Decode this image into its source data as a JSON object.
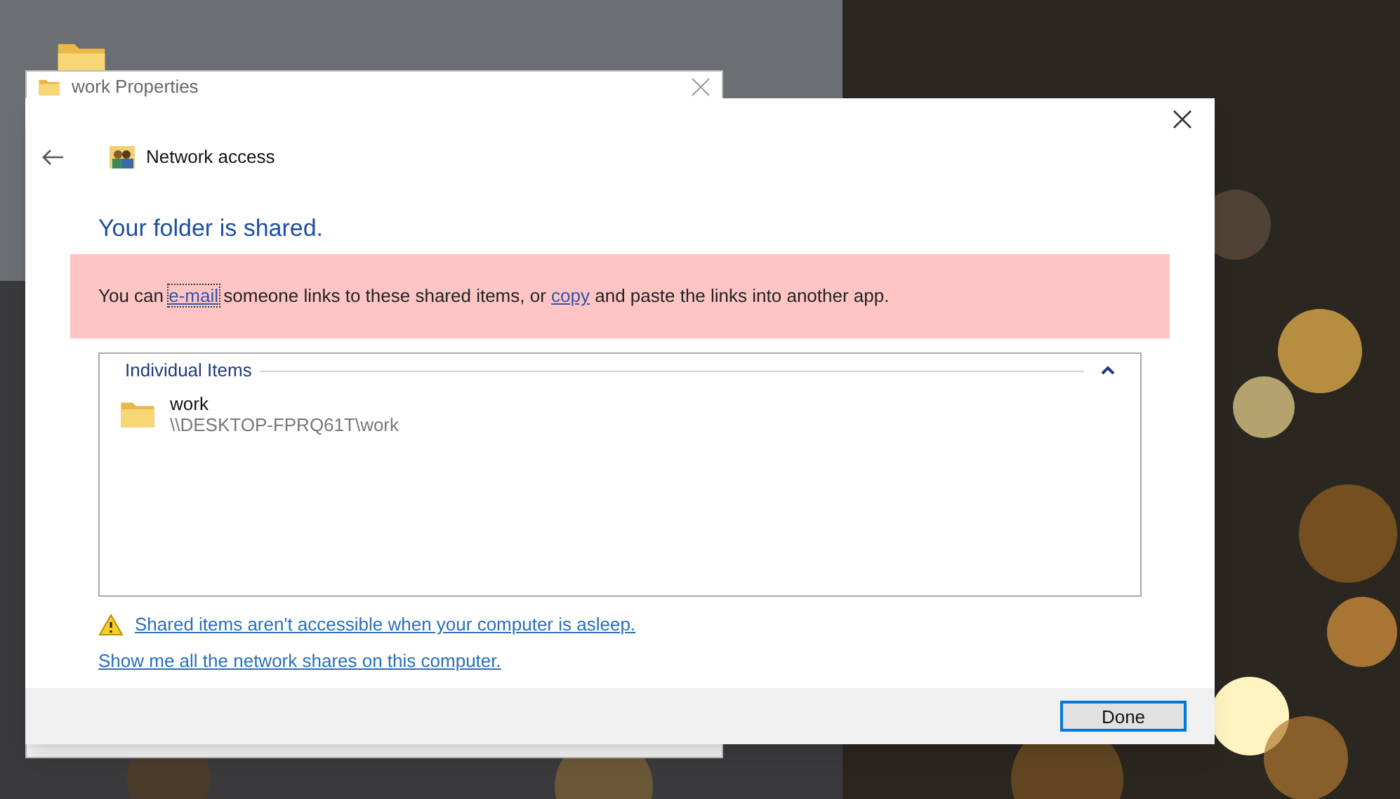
{
  "back_window": {
    "title": "work Properties"
  },
  "dialog": {
    "header": "Network access",
    "heading": "Your folder is shared.",
    "message": [
      {
        "kind": "text",
        "text": "You can "
      },
      {
        "kind": "link",
        "text": "e-mail",
        "focused": true
      },
      {
        "kind": "text",
        "text": " someone links to these shared items, or "
      },
      {
        "kind": "link",
        "text": "copy",
        "focused": false
      },
      {
        "kind": "text",
        "text": " and paste the links into another app."
      }
    ],
    "group": {
      "label": "Individual Items",
      "expanded": true,
      "items": [
        {
          "name": "work",
          "path": "\\\\DESKTOP-FPRQ61T\\work"
        }
      ]
    },
    "warning_link": "Shared items aren't accessible when your computer is asleep.",
    "shares_link": "Show me all the network shares on this computer.",
    "buttons": [
      {
        "label": "Done",
        "default": true
      }
    ]
  }
}
